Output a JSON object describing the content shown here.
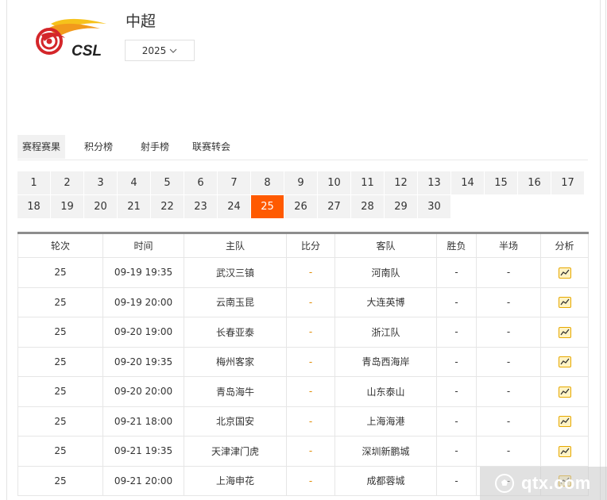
{
  "header": {
    "league_name": "中超",
    "season": "2025",
    "logo_text": "CSL",
    "brand_colors": {
      "red": "#d4262a",
      "orange": "#f29a1c",
      "yellow": "#f6c21b",
      "text": "#222222"
    }
  },
  "tabs": [
    {
      "label": "赛程赛果",
      "active": true
    },
    {
      "label": "积分榜",
      "active": false
    },
    {
      "label": "射手榜",
      "active": false
    },
    {
      "label": "联赛转会",
      "active": false
    }
  ],
  "rounds": [
    "1",
    "2",
    "3",
    "4",
    "5",
    "6",
    "7",
    "8",
    "9",
    "10",
    "11",
    "12",
    "13",
    "14",
    "15",
    "16",
    "17",
    "18",
    "19",
    "20",
    "21",
    "22",
    "23",
    "24",
    "25",
    "26",
    "27",
    "28",
    "29",
    "30"
  ],
  "selected_round": "25",
  "table": {
    "headers": [
      "轮次",
      "时间",
      "主队",
      "比分",
      "客队",
      "胜负",
      "半场",
      "分析"
    ],
    "rows": [
      {
        "round": "25",
        "time": "09-19 19:35",
        "home": "武汉三镇",
        "score": "-",
        "away": "河南队",
        "result": "-",
        "half": "-"
      },
      {
        "round": "25",
        "time": "09-19 20:00",
        "home": "云南玉昆",
        "score": "-",
        "away": "大连英博",
        "result": "-",
        "half": "-"
      },
      {
        "round": "25",
        "time": "09-20 19:00",
        "home": "长春亚泰",
        "score": "-",
        "away": "浙江队",
        "result": "-",
        "half": "-"
      },
      {
        "round": "25",
        "time": "09-20 19:35",
        "home": "梅州客家",
        "score": "-",
        "away": "青岛西海岸",
        "result": "-",
        "half": "-"
      },
      {
        "round": "25",
        "time": "09-20 20:00",
        "home": "青岛海牛",
        "score": "-",
        "away": "山东泰山",
        "result": "-",
        "half": "-"
      },
      {
        "round": "25",
        "time": "09-21 18:00",
        "home": "北京国安",
        "score": "-",
        "away": "上海海港",
        "result": "-",
        "half": "-"
      },
      {
        "round": "25",
        "time": "09-21 19:35",
        "home": "天津津门虎",
        "score": "-",
        "away": "深圳新鹏城",
        "result": "-",
        "half": "-"
      },
      {
        "round": "25",
        "time": "09-21 20:00",
        "home": "上海申花",
        "score": "-",
        "away": "成都蓉城",
        "result": "-",
        "half": "-"
      }
    ]
  },
  "icons": {
    "season_dropdown": "chevron-down-icon",
    "analysis": "analysis-chart-icon"
  },
  "accent_color": "#ff5a00",
  "score_color": "#e08a00",
  "watermark": {
    "text": "qtx.com"
  }
}
